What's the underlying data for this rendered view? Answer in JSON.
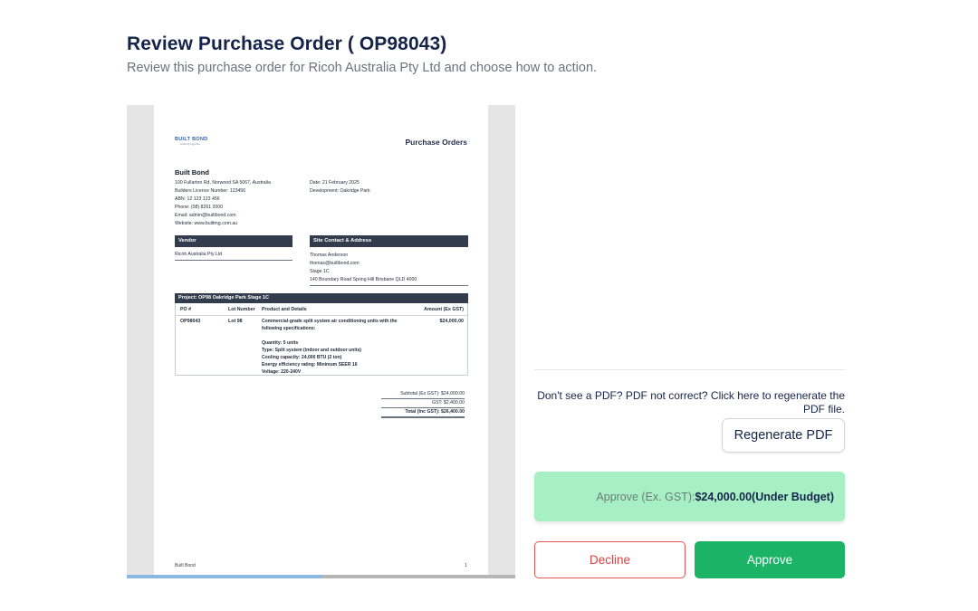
{
  "header": {
    "title": "Review Purchase Order ( OP98043)",
    "subtitle": "Review this purchase order for Ricoh Australia Pty Ltd and choose how to action."
  },
  "pdf": {
    "scroll_progress": 0.5,
    "logo_line1": "BUILT BOND",
    "logo_line2": "building together",
    "doc_title": "Purchase Orders",
    "company": {
      "name": "Built Bond",
      "lines": [
        "100 Fullarton Rd, Norwood SA 5067, Australia",
        "Builders Licence Number: 123456",
        "ABN: 12 123 123 456",
        "Phone: (08) 8261 2000",
        "Email: admin@builtbond.com",
        "Website: www.builtmg.com.au"
      ]
    },
    "meta": {
      "date": "Date: 21 February 2025",
      "development": "Development: Oakridge Park"
    },
    "vendor_header": "Vendor",
    "vendor_name": "Ricoh Australia Pty Ltd",
    "site_header": "Site Contact & Address",
    "site_lines": [
      "Thomas Anderson",
      "thomas@builtbond.com",
      "Stage 1C",
      "140 Boundary Road Spring Hill Brisbane QLD 4000"
    ],
    "project_header": "Project: OP98 Oakridge Park Stage 1C",
    "table_headers": {
      "po": "PO #",
      "lot": "Lot Number",
      "product": "Product and Details",
      "amount": "Amount (Ex GST)"
    },
    "row": {
      "po": "OP98043",
      "lot": "Lot 98",
      "desc_lines": [
        "Commercial-grade split system air conditioning units with the",
        "following specifications:",
        "",
        "Quantity: 5 units",
        "Type: Split system (indoor and outdoor units)",
        "Cooling capacity: 24,000 BTU (2 ton)",
        "Energy efficiency rating: Minimum SEER 16",
        "Voltage: 220-240V"
      ],
      "amount": "$24,000.00"
    },
    "totals": {
      "subtotal": "Subtotal (Ex GST): $24,000.00",
      "gst": "GST: $2,400.00",
      "total": "Total (Inc GST): $26,400.00"
    },
    "footer_left": "Built Bond",
    "footer_right": "1"
  },
  "regen": {
    "note": "Don't see a PDF? PDF not correct? Click here to regenerate the PDF file.",
    "button": "Regenerate PDF"
  },
  "approve_banner": {
    "label": "Approve (Ex. GST):",
    "amount": "$24,000.00",
    "status": "(Under Budget)"
  },
  "actions": {
    "decline": "Decline",
    "approve": "Approve"
  },
  "colors": {
    "approve": "#1bb366",
    "decline": "#d94141",
    "banner": "#a7f0c6",
    "pdf_bar": "#323c4c"
  }
}
